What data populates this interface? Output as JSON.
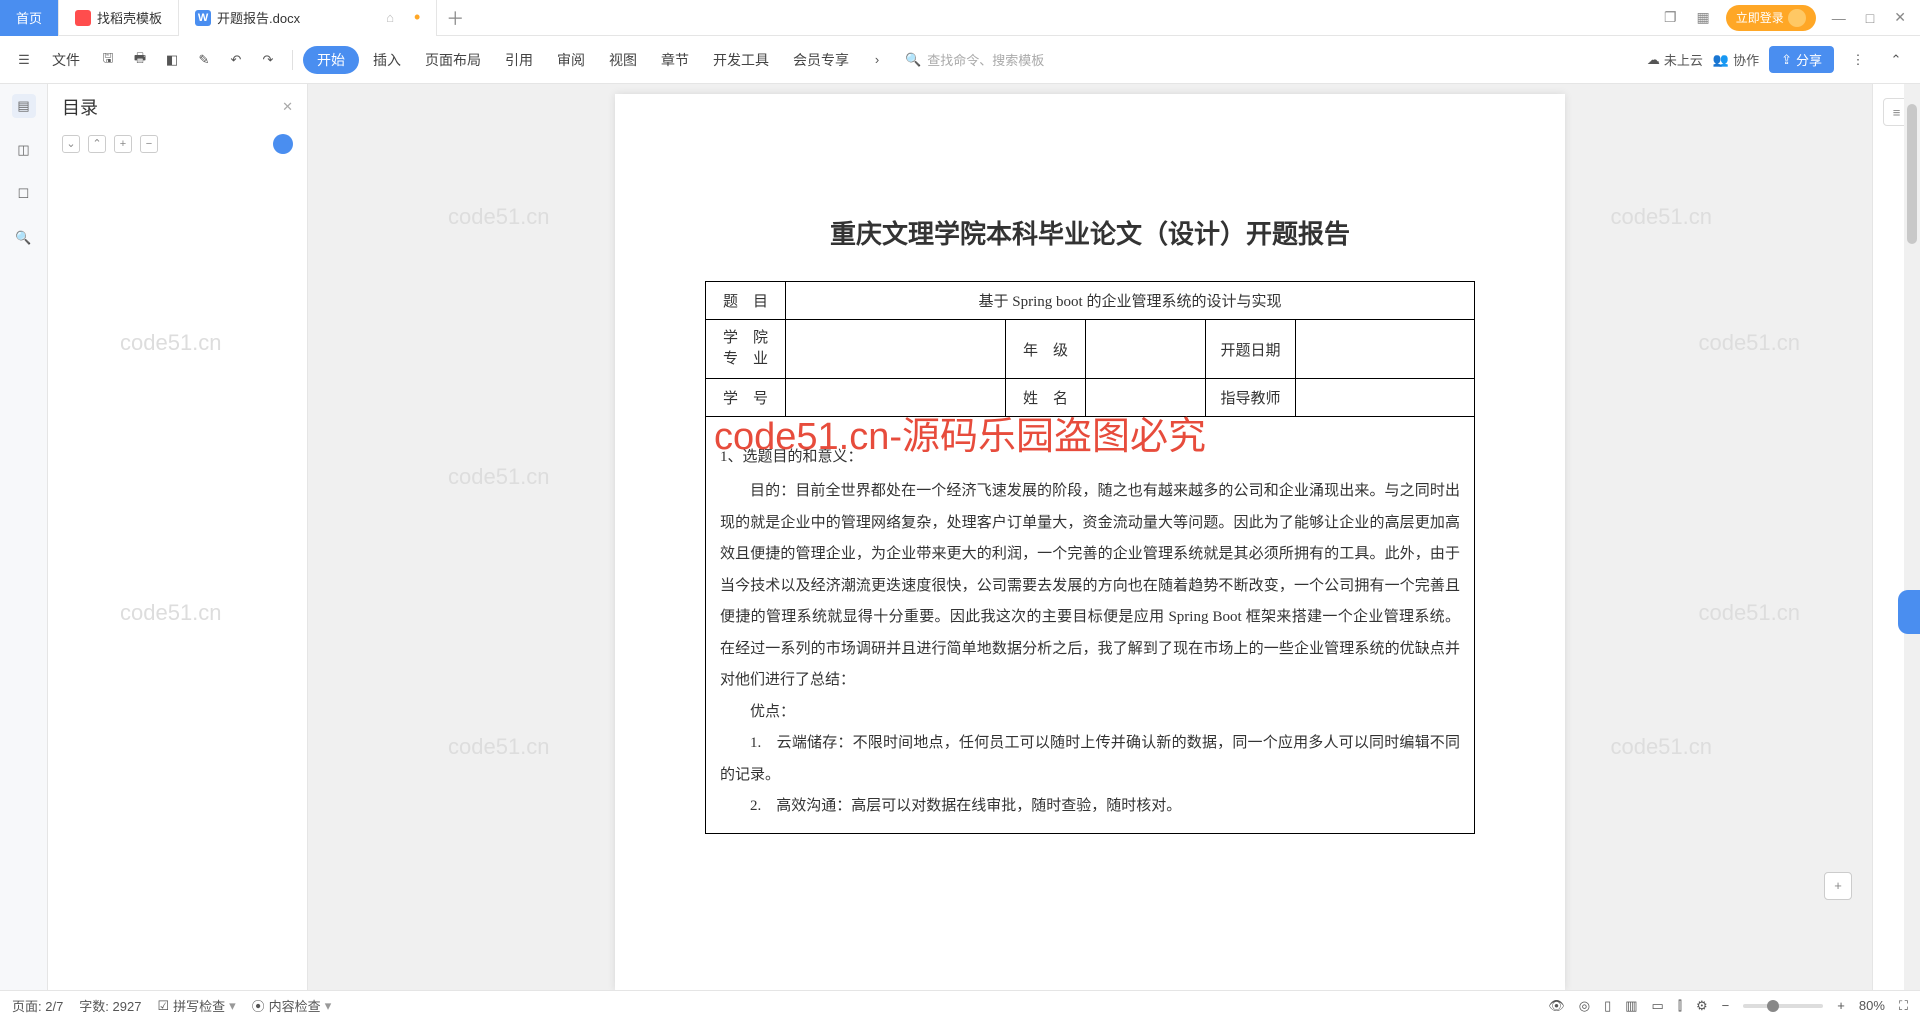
{
  "tabs": {
    "home": "首页",
    "t1": "找稻壳模板",
    "t2": "开题报告.docx"
  },
  "login": "立即登录",
  "menu": {
    "file": "文件",
    "start": "开始",
    "insert": "插入",
    "layout": "页面布局",
    "ref": "引用",
    "review": "审阅",
    "view": "视图",
    "chapter": "章节",
    "dev": "开发工具",
    "member": "会员专享"
  },
  "search_placeholder": "查找命令、搜索模板",
  "cloud": "未上云",
  "collab": "协作",
  "share": "分享",
  "outline": {
    "title": "目录"
  },
  "doc": {
    "title": "重庆文理学院本科毕业论文（设计）开题报告",
    "row1_lbl": "题　目",
    "row1_val": "基于 Spring boot 的企业管理系统的设计与实现",
    "row2_lbl": "学　院\n专　业",
    "grade_lbl": "年　级",
    "date_lbl": "开题日期",
    "row3_lbl": "学　号",
    "name_lbl": "姓　名",
    "advisor_lbl": "指导教师",
    "sec1": "1、选题目的和意义：",
    "p1": "目的：目前全世界都处在一个经济飞速发展的阶段，随之也有越来越多的公司和企业涌现出来。与之同时出现的就是企业中的管理网络复杂，处理客户订单量大，资金流动量大等问题。因此为了能够让企业的高层更加高效且便捷的管理企业，为企业带来更大的利润，一个完善的企业管理系统就是其必须所拥有的工具。此外，由于当今技术以及经济潮流更迭速度很快，公司需要去发展的方向也在随着趋势不断改变，一个公司拥有一个完善且便捷的管理系统就显得十分重要。因此我这次的主要目标便是应用 Spring Boot 框架来搭建一个企业管理系统。在经过一系列的市场调研并且进行简单地数据分析之后，我了解到了现在市场上的一些企业管理系统的优缺点并对他们进行了总结：",
    "adv": "优点：",
    "li1": "1.　云端储存：不限时间地点，任何员工可以随时上传并确认新的数据，同一个应用多人可以同时编辑不同的记录。",
    "li2": "2.　高效沟通：高层可以对数据在线审批，随时查验，随时核对。"
  },
  "watermark": "code51.cn",
  "watermark_red": "code51.cn-源码乐园盗图必究",
  "status": {
    "page": "页面: 2/7",
    "words": "字数: 2927",
    "spell": "拼写检查",
    "content": "内容检查",
    "zoom": "80%"
  }
}
